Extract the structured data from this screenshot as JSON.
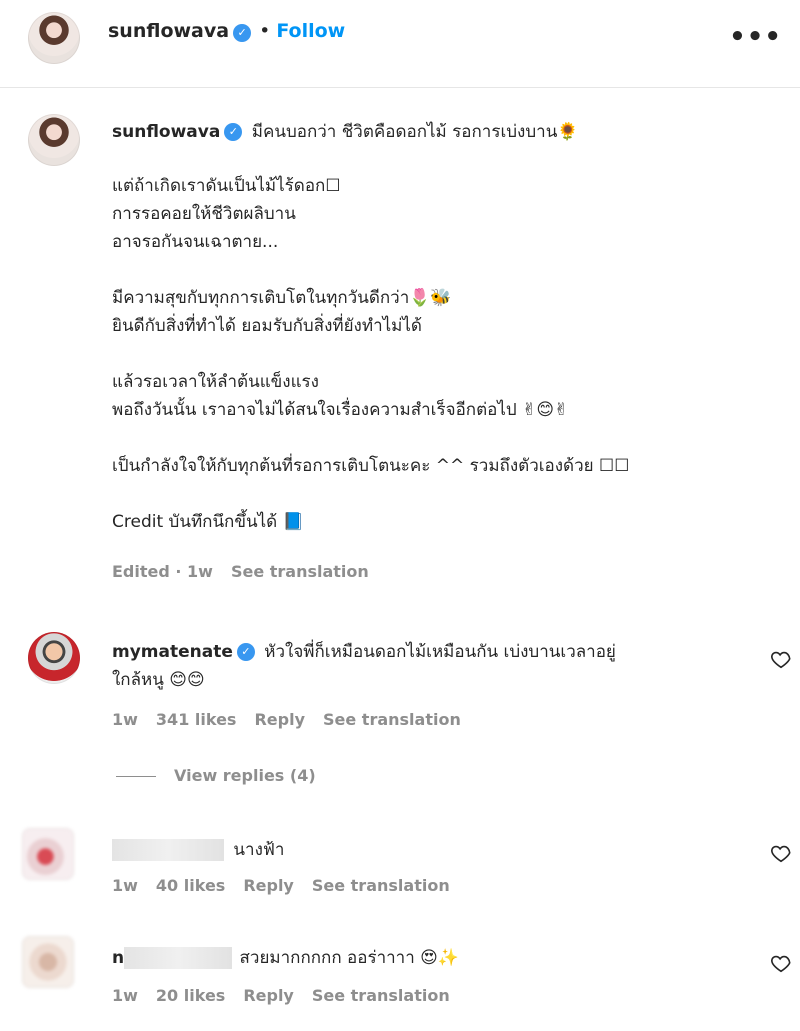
{
  "header": {
    "username": "sunflowava",
    "verified_mark": "✓",
    "separator": "•",
    "follow_label": "Follow",
    "more_label": "•••"
  },
  "caption": {
    "username": "sunflowava",
    "lines": [
      "มีคนบอกว่า ชีวิตคือดอกไม้ รอการเบ่งบาน🌻",
      "แต่ถ้าเกิดเราดันเป็นไม้ไร้ดอก☐",
      "การรอคอยให้ชีวิตผลิบาน",
      "อาจรอกันจนเฉาตาย...",
      "มีความสุขกับทุกการเติบโตในทุกวันดีกว่า🌷🐝",
      "ยินดีกับสิ่งที่ทำได้ ยอมรับกับสิ่งที่ยังทำไม่ได้",
      "แล้วรอเวลาให้ลำต้นแข็งแรง",
      "พอถึงวันนั้น เราอาจไม่ได้สนใจเรื่องความสำเร็จอีกต่อไป ✌😊✌",
      "เป็นกำลังใจให้กับทุกต้นที่รอการเติบโตนะคะ ^^ รวมถึงตัวเองด้วย ☐☐",
      "Credit บันทึกนึกขึ้นได้ 📘"
    ],
    "edited": "Edited · 1w",
    "see_translation": "See translation"
  },
  "comments": [
    {
      "username": "mymatenate",
      "verified": true,
      "text_line1": "หัวใจพี่ก็เหมือนดอกไม้เหมือนกัน เบ่งบานเวลาอยู่",
      "text_line2": "ใกล้หนู 😊😊",
      "time": "1w",
      "likes": "341 likes",
      "reply": "Reply",
      "see_translation": "See translation",
      "view_replies": "View replies (4)"
    },
    {
      "username": "",
      "text": "นางฟ้า",
      "time": "1w",
      "likes": "40 likes",
      "reply": "Reply",
      "see_translation": "See translation"
    },
    {
      "username_prefix": "n",
      "text": "สวยมากกกกก ออร่าาาา 😍✨",
      "time": "1w",
      "likes": "20 likes",
      "reply": "Reply",
      "see_translation": "See translation"
    }
  ],
  "icons": {
    "verified": "verified-badge-icon",
    "heart": "heart-outline-icon",
    "more": "more-options-icon"
  },
  "colors": {
    "follow": "#0095f6",
    "verified": "#3897f0",
    "meta": "#8e8e8e"
  }
}
